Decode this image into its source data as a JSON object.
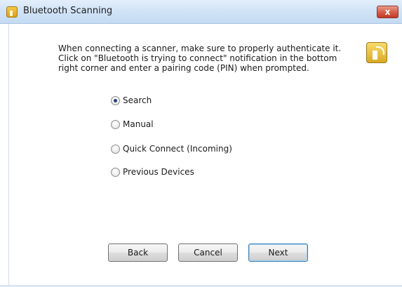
{
  "window": {
    "title": "Bluetooth Scanning",
    "close_label": "x"
  },
  "instructions": {
    "lines": [
      "When connecting a scanner, make sure to properly authenticate it.",
      "Click on \"Bluetooth is trying to connect\" notification in the bottom",
      "right corner and enter a pairing code (PIN) when prompted."
    ]
  },
  "scan_modes": {
    "selected": "Search",
    "options": [
      {
        "label": "Search",
        "checked": true
      },
      {
        "label": "Manual",
        "checked": false
      },
      {
        "label": "Quick Connect (Incoming)",
        "checked": false
      },
      {
        "label": "Previous Devices",
        "checked": false
      }
    ]
  },
  "buttons": {
    "back": "Back",
    "cancel": "Cancel",
    "next": "Next"
  },
  "icons": {
    "app": "bluetooth-scanner-app-icon",
    "header": "bluetooth-scanner-icon",
    "close": "close-icon"
  },
  "colors": {
    "titlebar": "#d2e4f7",
    "close_button": "#d8604c",
    "icon_gold": "#e0b02c"
  }
}
